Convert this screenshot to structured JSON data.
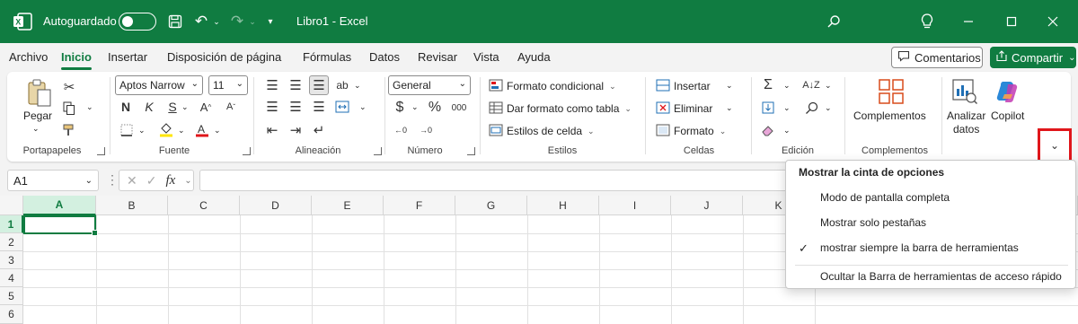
{
  "titlebar": {
    "autosave_label": "Autoguardado",
    "doc_title": "Libro1  -  Excel",
    "bg_color": "#107c41"
  },
  "tabs": [
    "Archivo",
    "Inicio",
    "Insertar",
    "Disposición de página",
    "Fórmulas",
    "Datos",
    "Revisar",
    "Vista",
    "Ayuda"
  ],
  "active_tab": "Inicio",
  "comments_label": "Comentarios",
  "share_label": "Compartir",
  "ribbon": {
    "paste_label": "Pegar",
    "font_name": "Aptos Narrow",
    "font_size": "11",
    "bold": "N",
    "italic": "K",
    "underline": "S",
    "number_format": "General",
    "cond_format": "Formato condicional",
    "table_format": "Dar formato como tabla",
    "cell_styles": "Estilos de celda",
    "insert": "Insertar",
    "delete": "Eliminar",
    "format": "Formato",
    "addins": "Complementos",
    "analyze_line1": "Analizar",
    "analyze_line2": "datos",
    "copilot": "Copilot",
    "groups": {
      "clipboard": "Portapapeles",
      "font": "Fuente",
      "alignment": "Alineación",
      "number": "Número",
      "styles": "Estilos",
      "cells": "Celdas",
      "editing": "Edición",
      "addins": "Complementos"
    }
  },
  "formula_bar": {
    "name_box": "A1",
    "fx": "fx"
  },
  "grid": {
    "columns": [
      "A",
      "B",
      "C",
      "D",
      "E",
      "F",
      "G",
      "H",
      "I",
      "J",
      "K"
    ],
    "rows": [
      "1",
      "2",
      "3",
      "4",
      "5",
      "6"
    ]
  },
  "ribbon_menu": {
    "header": "Mostrar la cinta de opciones",
    "items": [
      "Modo de pantalla completa",
      "Mostrar solo pestañas",
      "mostrar siempre la barra de herramientas",
      "Ocultar la Barra de herramientas de acceso rápido"
    ],
    "checked": "mostrar siempre la barra de herramientas"
  }
}
